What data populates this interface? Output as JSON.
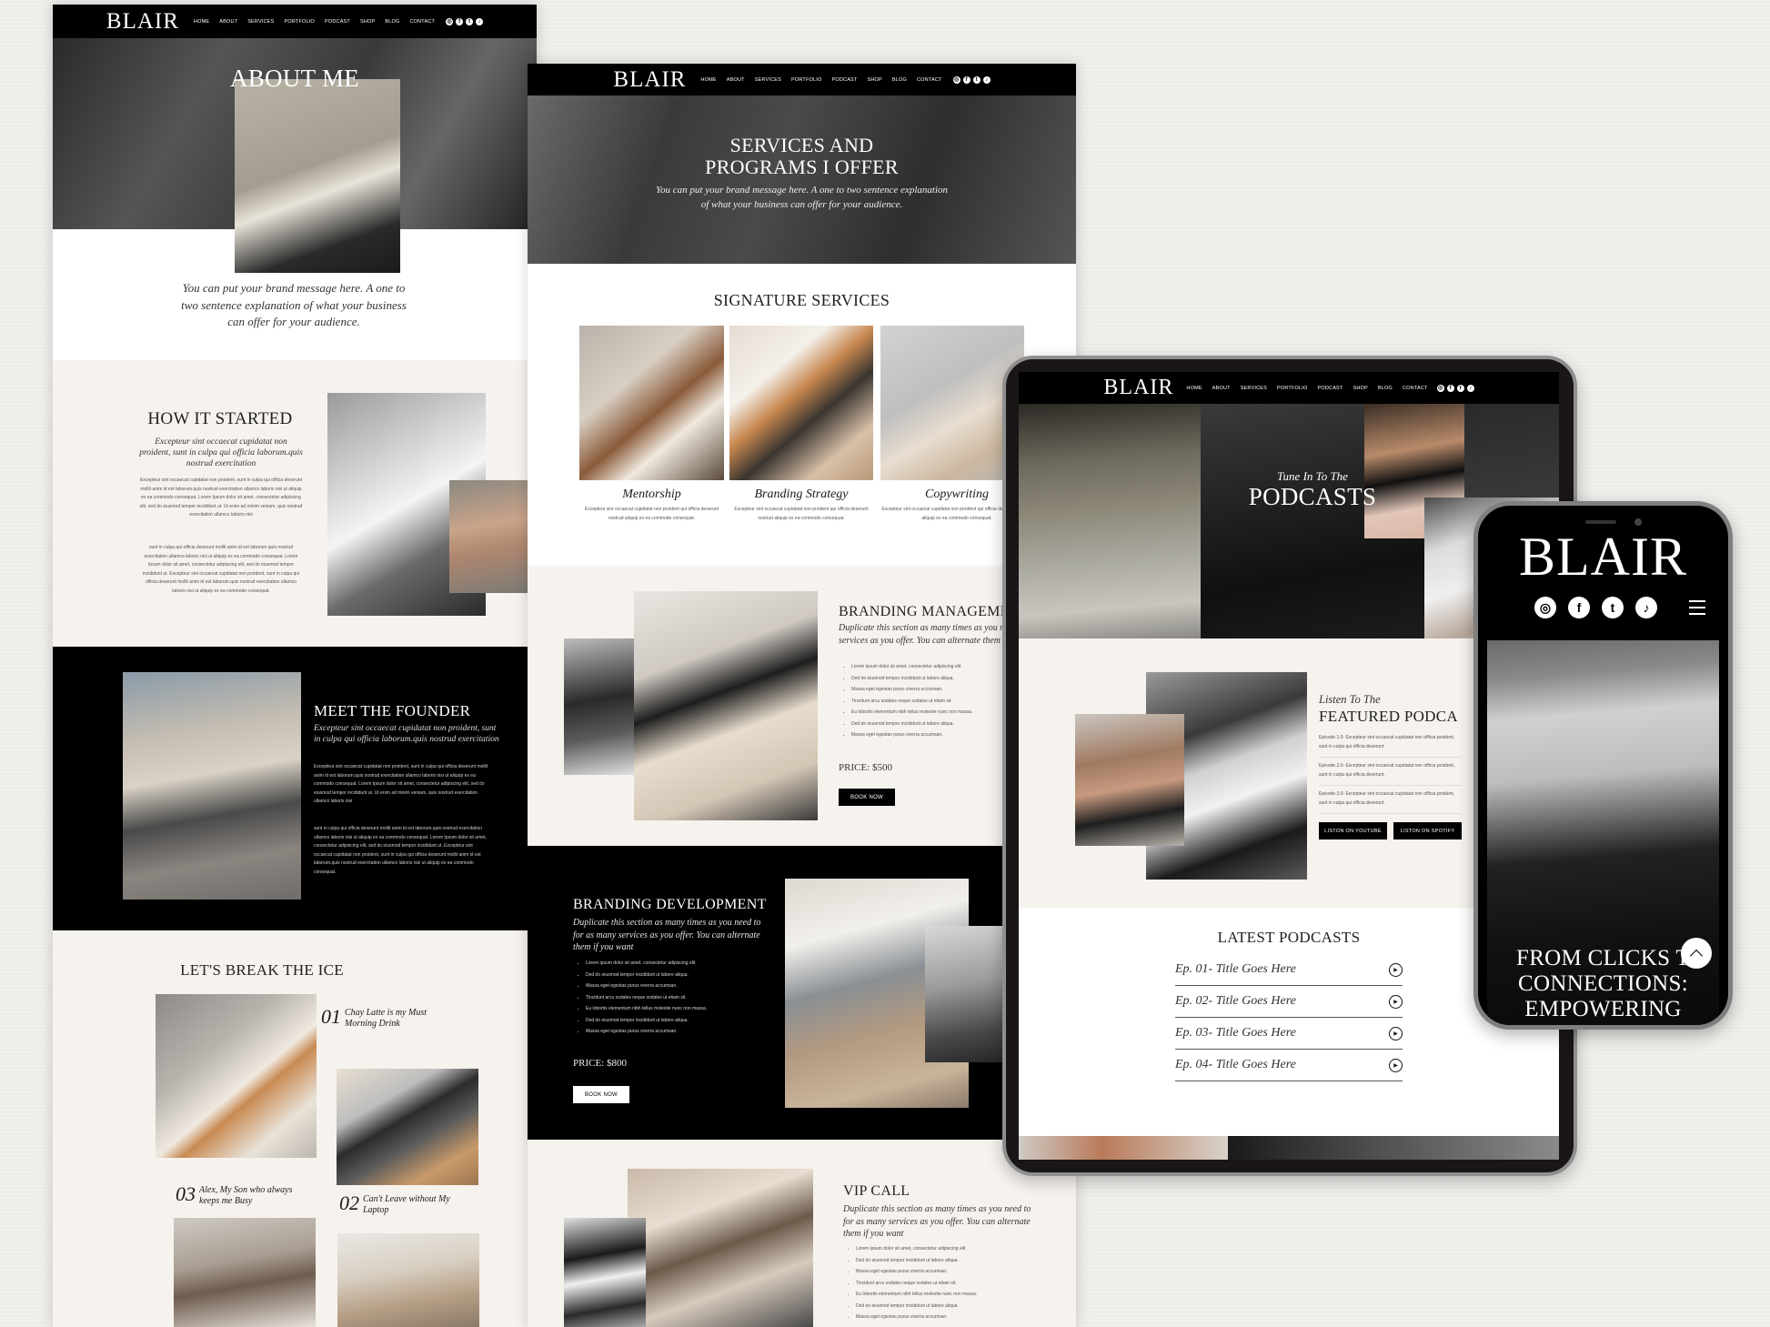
{
  "brand": "BLAIR",
  "nav": {
    "links": [
      "HOME",
      "ABOUT",
      "SERVICES",
      "PORTFOLIO",
      "PODCAST",
      "SHOP",
      "BLOG",
      "CONTACT"
    ],
    "socials": [
      {
        "icon": "instagram-icon",
        "glyph": "◎"
      },
      {
        "icon": "facebook-icon",
        "glyph": "f"
      },
      {
        "icon": "twitter-icon",
        "glyph": "t"
      },
      {
        "icon": "tiktok-icon",
        "glyph": "♪"
      }
    ]
  },
  "colors": {
    "black": "#000000",
    "beige": "#f6f2ee",
    "white": "#ffffff",
    "text_dark": "#1a1a1a",
    "text_muted": "#555555"
  },
  "about_page": {
    "hero_title": "ABOUT ME",
    "brand_message": "You can put your brand message here. A one to two sentence explanation of what your business can offer for your audience.",
    "how_it_started": {
      "title": "HOW IT STARTED",
      "subtitle": "Excepteur sint occaecat cupidatat non proident, sunt in culpa qui officia laborum.quis nostrud exercitation",
      "para1": "Excepteur sint occaecat cupidatat non proident, sunt in culpa qui officia deserunt mollit anim id est laborum.quis nostrud exercitation ullamco laboris nisi ut aliquip ex ea commodo consequat. Lorem Ipsum dolor sit amet, consectetur adipiscing elit, sed do eiusmod tempor incididunt ut. Ut enim ad minim veniam, quis nostrud exercitation ullamco laboris nisi",
      "para2": "sunt in culpa qui officia deserunt mollit anim id est laborum.quis nostrud exercitation ullamco laboris nisi ut aliquip ex ea commodo consequat. Lorem Ipsum dolor sit amet, consectetur adipiscing elit, sed do eiusmod tempor incididunt ut. Excepteur sint occaecat cupidatat non proident, sunt in culpa qui officia deserunt mollit anim id est laborum.quis nostrud exercitation ullamco laboris nisi ut aliquip ex ea commodo consequat."
    },
    "meet_the_founder": {
      "title": "MEET THE FOUNDER",
      "subtitle": "Excepteur sint occaecat cupidatat non proident, sunt in culpa qui officia laborum.quis nostrud exercitation",
      "para1": "Excepteur sint occaecat cupidatat non proident, sunt in culpa qui officia deserunt mollit anim id est laborum.quis nostrud exercitation ullamco laboris nisi ut aliquip ex ea commodo consequat. Lorem Ipsum dolor sit amet, consectetur adipiscing elit, sed do eiusmod tempor incididunt ut. Ut enim ad minim veniam, quis nostrud exercitation ullamco laboris nisi",
      "para2": "sunt in culpa qui officia deserunt mollit anim id est laborum.quis nostrud exercitation ullamco laboris nisi ut aliquip ex ea commodo consequat. Lorem Ipsum dolor sit amet, consectetur adipiscing elit, sed do eiusmod tempor incididunt ut. Excepteur sint occaecat cupidatat non proident, sunt in culpa qui officia deserunt mollit anim id est laborum.quis nostrud exercitation ullamco laboris nisi ut aliquip ex ea commodo consequat."
    },
    "ice_breaker": {
      "title": "LET'S BREAK THE ICE",
      "facts": [
        {
          "num": "01",
          "text": "Chay Latte is my Must Morning Drink"
        },
        {
          "num": "02",
          "text": "Can't Leave without My Laptop"
        },
        {
          "num": "03",
          "text": "Alex, My Son who always keeps me Busy"
        }
      ]
    }
  },
  "services_page": {
    "hero_title_line1": "SERVICES AND",
    "hero_title_line2": "PROGRAMS I OFFER",
    "hero_subtitle": "You can put your brand message here. A one to two sentence explanation of what your business can offer for your audience.",
    "signature_title": "SIGNATURE SERVICES",
    "signature_services": [
      {
        "name": "Mentorship",
        "desc": "Excepteur sint occaecat cupidatat non proident qui officia deserunt nostrud aliquip ex ea commodo consequat."
      },
      {
        "name": "Branding Strategy",
        "desc": "Excepteur sint occaecat cupidatat non proident qui officia deserunt nostrud aliquip ex ea commodo consequat."
      },
      {
        "name": "Copywriting",
        "desc": "Excepteur sint occaecat cupidatat non proident qui officia deserunt nostrud aliquip ex ea commodo consequat."
      }
    ],
    "offers": [
      {
        "title": "BRANDING MANAGEMENT",
        "subtitle": "Duplicate this section as many times as you need to for as many services as you offer. You can alternate them if you want",
        "bullets": [
          "Lorem ipsum dolor sit amet, consectetur adipiscing elit",
          "Ded do eiusmod tempor incididunt ut labore aliqua.",
          "Massa eget egestas purus viverra accumsan.",
          "Tincidunt arcu sodales neque sodales ut etiam sit.",
          "Eu lobortis elementum nibh tellus molestie nunc non massa.",
          "Ded do eiusmod tempor incididunt ut labore aliqua.",
          "Massa eget egestas purus viverra accumsan."
        ],
        "price": "PRICE: $500",
        "button": "BOOK NOW"
      },
      {
        "title": "BRANDING DEVELOPMENT",
        "subtitle": "Duplicate this section as many times as you need to for as many services as you offer. You can alternate them if you want",
        "bullets": [
          "Lorem ipsum dolor sit amet, consectetur adipiscing elit",
          "Ded do eiusmod tempor incididunt ut labore aliqua.",
          "Massa eget egestas purus viverra accumsan.",
          "Tincidunt arcu sodales neque sodales ut etiam sit.",
          "Eu lobortis elementum nibh tellus molestie nunc non massa.",
          "Ded do eiusmod tempor incididunt ut labore aliqua.",
          "Massa eget egestas purus viverra accumsan."
        ],
        "price": "PRICE: $800",
        "button": "BOOK NOW"
      },
      {
        "title": "VIP CALL",
        "subtitle": "Duplicate this section as many times as you need to for as many services as you offer. You can alternate them if you want",
        "bullets": [
          "Lorem ipsum dolor sit amet, consectetur adipiscing elit",
          "Ded do eiusmod tempor incididunt ut labore aliqua.",
          "Massa eget egestas purus viverra accumsan.",
          "Tincidunt arcu sodales neque sodales ut etiam sit.",
          "Eu lobortis elementum nibh tellus molestie nunc non massa.",
          "Ded do eiusmod tempor incididunt ut labore aliqua.",
          "Massa eget egestas purus viverra accumsan."
        ]
      }
    ]
  },
  "podcast_page": {
    "hero_kicker": "Tune In To The",
    "hero_title": "PODCASTS",
    "featured_kicker": "Listen To The",
    "featured_title": "FEATURED PODCA",
    "episodes": [
      "Episode 1.0- Excepteur sint occaecat cupidatat non officia proident, sunt in culpa qui officia deserunt.",
      "Episode 2.0- Excepteur sint occaecat cupidatat non officia proident, sunt in culpa qui officia deserunt.",
      "Episode 3.0- Excepteur sint occaecat cupidatat non officia proident, sunt in culpa qui officia deserunt."
    ],
    "buttons": [
      "LISTON ON YOUTUBE",
      "LISTON ON SPOTIFY"
    ],
    "latest_title": "LATEST PODCASTS",
    "latest": [
      "Ep. 01- Title Goes Here",
      "Ep. 02- Title Goes Here",
      "Ep. 03- Title Goes Here",
      "Ep. 04- Title Goes Here"
    ]
  },
  "mobile": {
    "hero_title": "FROM CLICKS TO CONNECTIONS: EMPOWERING",
    "hero_title_visible": "FROM CLICKS T\nCONNECTIONS:\nEMPOWERING"
  }
}
